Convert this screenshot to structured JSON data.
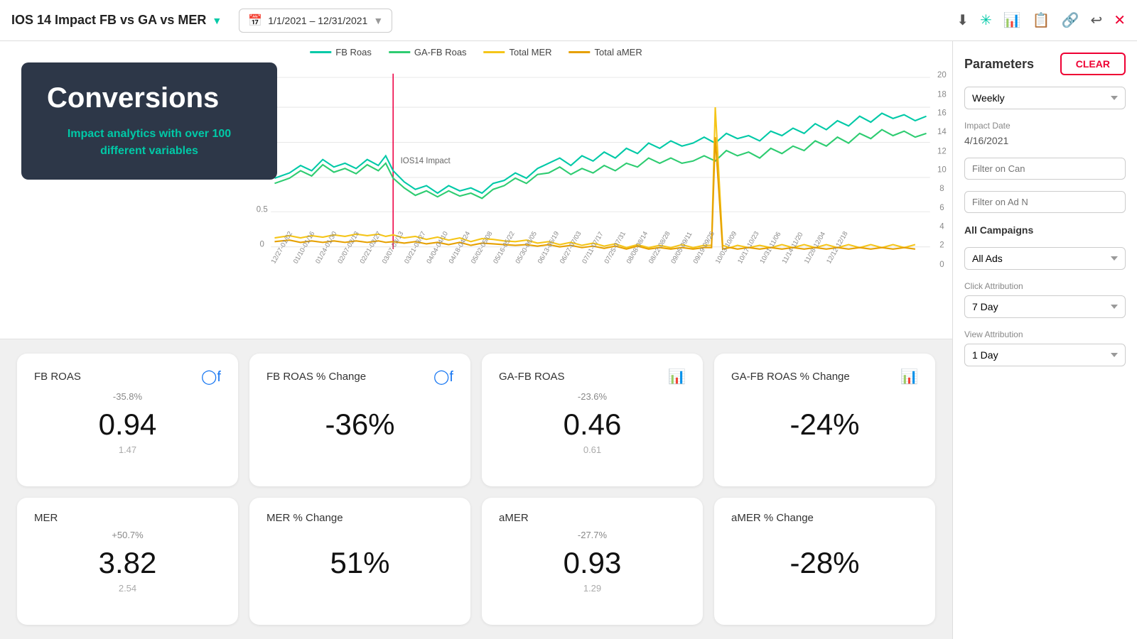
{
  "header": {
    "title": "IOS 14 Impact FB vs GA vs MER",
    "date_range": "1/1/2021 – 12/31/2021",
    "icons": [
      "download",
      "asterisk",
      "bar-chart",
      "clipboard",
      "link",
      "refresh",
      "close"
    ]
  },
  "hero": {
    "title": "Conversions",
    "subtitle": "Impact analytics with over 100 different variables"
  },
  "chart": {
    "legend": [
      {
        "label": "FB Roas",
        "color": "#00c9a7"
      },
      {
        "label": "GA-FB Roas",
        "color": "#2ecc71"
      },
      {
        "label": "Total MER",
        "color": "#f5c518"
      },
      {
        "label": "Total aMER",
        "color": "#e6a000"
      }
    ],
    "ios14_label": "IOS14 Impact",
    "left_axis_max": 2.5,
    "right_axis_max": 20
  },
  "cards": [
    {
      "title": "FB ROAS",
      "icon": "fb",
      "change": "-35.8%",
      "value": "0.94",
      "prev": "1.47"
    },
    {
      "title": "FB ROAS % Change",
      "icon": "fb",
      "change": "",
      "value": "-36%",
      "prev": ""
    },
    {
      "title": "GA-FB ROAS",
      "icon": "bar",
      "change": "-23.6%",
      "value": "0.46",
      "prev": "0.61"
    },
    {
      "title": "GA-FB ROAS % Change",
      "icon": "bar",
      "change": "",
      "value": "-24%",
      "prev": ""
    },
    {
      "title": "MER",
      "icon": "none",
      "change": "+50.7%",
      "value": "3.82",
      "prev": "2.54"
    },
    {
      "title": "MER % Change",
      "icon": "none",
      "change": "",
      "value": "51%",
      "prev": ""
    },
    {
      "title": "aMER",
      "icon": "none",
      "change": "-27.7%",
      "value": "0.93",
      "prev": "1.29"
    },
    {
      "title": "aMER % Change",
      "icon": "none",
      "change": "",
      "value": "-28%",
      "prev": ""
    }
  ],
  "panel": {
    "title": "Parameters",
    "clear_label": "CLEAR",
    "granularity_label": "Weekly",
    "impact_date_label": "Impact Date",
    "impact_date": "4/16/2021",
    "filter_campaign_placeholder": "Filter on Can",
    "filter_ad_placeholder": "Filter on Ad N",
    "all_campaigns_label": "All Campaigns",
    "all_ads_label": "All Ads",
    "click_attribution_label": "Click Attribution",
    "click_attribution_value": "7 Day",
    "view_attribution_label": "View Attribution",
    "view_attribution_value": "1 Day"
  }
}
